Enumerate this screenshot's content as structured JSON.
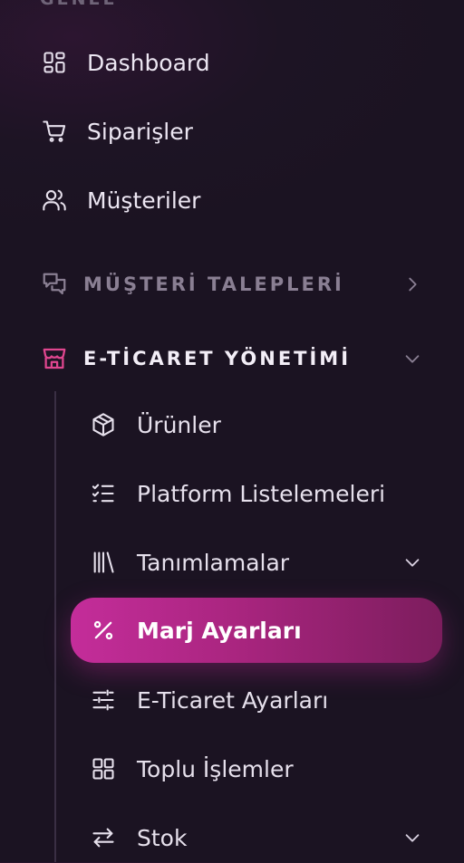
{
  "section": {
    "label": "GENEL"
  },
  "menu": {
    "dashboard": {
      "label": "Dashboard",
      "icon": "dashboard-grid-icon"
    },
    "siparisler": {
      "label": "Siparişler",
      "icon": "cart-icon"
    },
    "musteriler": {
      "label": "Müşteriler",
      "icon": "users-icon"
    }
  },
  "groups": {
    "talepler": {
      "label": "MÜŞTERİ TALEPLERİ",
      "icon": "chat-bubbles-icon",
      "color": "#8a7f93"
    },
    "eticaret": {
      "label": "E-TİCARET YÖNETİMİ",
      "icon": "store-icon",
      "color": "#f3eef7",
      "icon_color": "#e0468f"
    }
  },
  "submenu": {
    "urunler": {
      "label": "Ürünler",
      "icon": "package-icon"
    },
    "platform": {
      "label": "Platform Listelemeleri",
      "icon": "checklist-icon"
    },
    "tanimlamalar": {
      "label": "Tanımlamalar",
      "icon": "library-icon"
    },
    "marj": {
      "label": "Marj Ayarları",
      "icon": "percent-icon"
    },
    "eticaret_ayarlari": {
      "label": "E-Ticaret Ayarları",
      "icon": "sliders-icon"
    },
    "toplu": {
      "label": "Toplu İşlemler",
      "icon": "grid-icon"
    },
    "stok": {
      "label": "Stok",
      "icon": "arrows-swap-icon"
    }
  },
  "colors": {
    "accent": "#c42d9a",
    "background": "#1d1424"
  }
}
